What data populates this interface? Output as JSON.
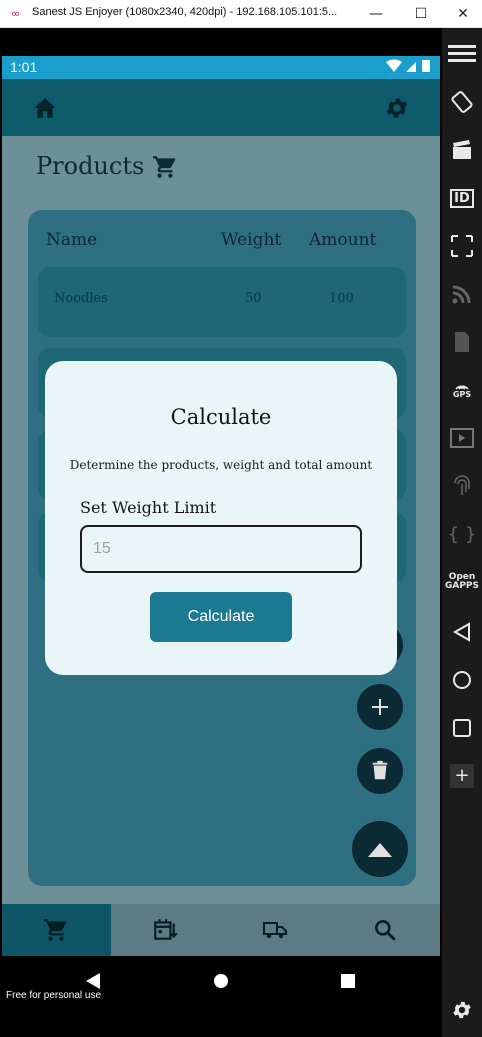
{
  "window": {
    "title": "Sanest JS Enjoyer (1080x2340, 420dpi) - 192.168.105.101:5...",
    "minimize_glyph": "—",
    "maximize_glyph": "☐",
    "close_glyph": "✕"
  },
  "status_bar": {
    "time": "1:01",
    "icons": "▼◢▮"
  },
  "page": {
    "title": "Products"
  },
  "table": {
    "headers": [
      "Name",
      "Weight",
      "Amount"
    ],
    "rows": [
      {
        "name": "Noodles",
        "weight": "50",
        "amount": "100"
      }
    ]
  },
  "dialog": {
    "title": "Calculate",
    "description": "Determine the products, weight and total amount",
    "label": "Set Weight Limit",
    "input_placeholder": "15",
    "button_label": "Calculate"
  },
  "footer_note": "Free for personal use",
  "toolbar": {
    "id_label": "ID",
    "gps_label": "GPS",
    "opengapps_label": "Open\nGAPPS",
    "plus_label": "+"
  },
  "colors": {
    "appbar": "#0d5b6b",
    "statusbar_accent": "#1a9ecb",
    "dialog_bg": "#e9f5f7",
    "dialog_button": "#1b7a92",
    "fab": "#0b2a33"
  }
}
